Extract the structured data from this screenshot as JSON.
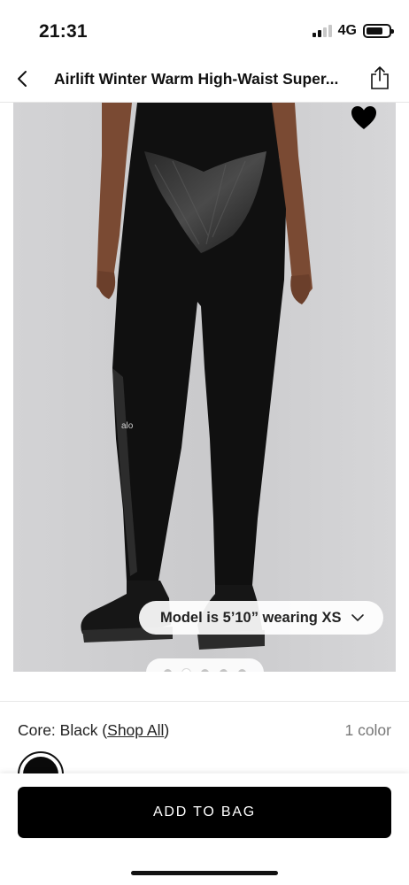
{
  "status_bar": {
    "time": "21:31",
    "network": "4G",
    "icons": [
      "signal-icon",
      "battery-icon"
    ]
  },
  "header": {
    "title": "Airlift Winter Warm High-Waist Super...",
    "icons": [
      "chevron-left-icon",
      "share-icon"
    ]
  },
  "gallery": {
    "brand_mark": "alo",
    "model_info": "Model is 5’10” wearing XS",
    "image_count": 5,
    "active_index": 1,
    "wishlisted": true,
    "icons": [
      "heart-icon",
      "chevron-down-icon"
    ]
  },
  "color": {
    "prefix": "Core: Black (",
    "link": "Shop All",
    "suffix": ")",
    "count": "1 color",
    "swatch_hex": "#0a0a0a"
  },
  "cta": {
    "add_to_bag": "ADD TO BAG"
  }
}
